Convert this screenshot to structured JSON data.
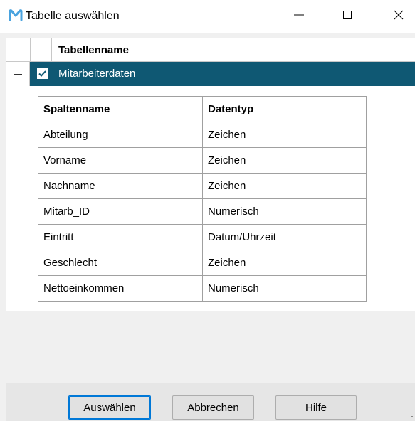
{
  "window": {
    "title": "Tabelle auswählen",
    "app_icon": "m-logo-icon",
    "controls": [
      "minimize-icon",
      "maximize-icon",
      "close-icon"
    ]
  },
  "table_list": {
    "header": "Tabellenname",
    "selected_row": {
      "label": "Mitarbeiterdaten",
      "checked": true,
      "expanded": true
    },
    "columns_table": {
      "headers": [
        "Spaltenname",
        "Datentyp"
      ],
      "rows": [
        [
          "Abteilung",
          "Zeichen"
        ],
        [
          "Vorname",
          "Zeichen"
        ],
        [
          "Nachname",
          "Zeichen"
        ],
        [
          "Mitarb_ID",
          "Numerisch"
        ],
        [
          "Eintritt",
          "Datum/Uhrzeit"
        ],
        [
          "Geschlecht",
          "Zeichen"
        ],
        [
          "Nettoeinkommen",
          "Numerisch"
        ]
      ]
    }
  },
  "buttons": {
    "select": "Auswählen",
    "cancel": "Abbrechen",
    "help": "Hilfe"
  },
  "colors": {
    "selection": "#0f5873",
    "app_icon": "#4aa3df",
    "default_button_border": "#0078d7"
  }
}
